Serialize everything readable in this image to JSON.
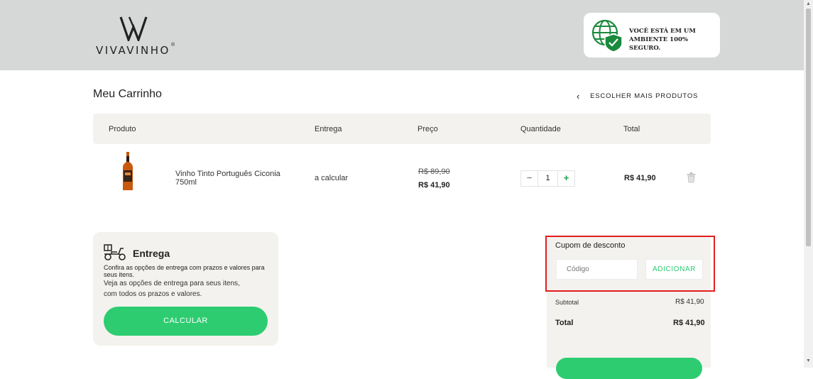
{
  "header": {
    "logo_text": "VIVAVINHO",
    "logo_reg": "®",
    "secure_text": "VOCÊ ESTÁ EM UM AMBIENTE 100% SEGURO."
  },
  "cart": {
    "title": "Meu Carrinho",
    "back_link": "ESCOLHER MAIS PRODUTOS",
    "columns": [
      "Produto",
      "Entrega",
      "Preço",
      "Quantidade",
      "Total"
    ],
    "items": [
      {
        "name": "Vinho Tinto Português Ciconia 750ml",
        "delivery": "a calcular",
        "old_price": "R$ 89,90",
        "price": "R$ 41,90",
        "quantity": "1",
        "total": "R$ 41,90"
      }
    ]
  },
  "shipping": {
    "title": "Entrega",
    "description": "Confira as opções de entrega com prazos e valores para seus itens.",
    "line1": "Veja as opções de entrega para seus itens,",
    "line2": "com todos os prazos e valores.",
    "button": "CALCULAR"
  },
  "summary": {
    "coupon_label": "Cupom de desconto",
    "coupon_placeholder": "Código",
    "coupon_button": "ADICIONAR",
    "subtotal_label": "Subtotal",
    "subtotal_value": "R$ 41,90",
    "total_label": "Total",
    "total_value": "R$ 41,90"
  },
  "colors": {
    "accent_green": "#2ecc71",
    "header_bg": "#d6d7d7",
    "panel_bg": "#f4f2ee",
    "highlight_red": "#e11d1d"
  }
}
